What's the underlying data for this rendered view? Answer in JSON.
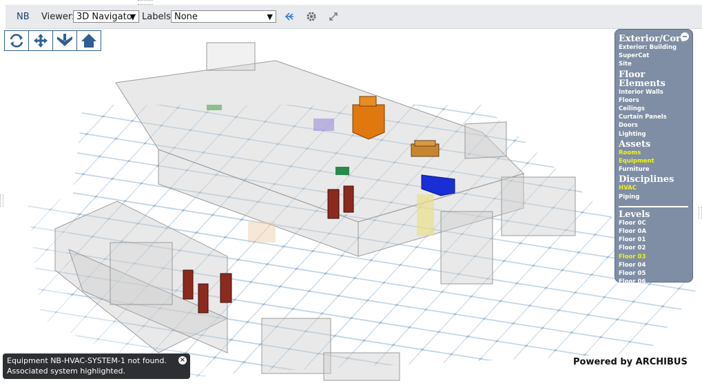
{
  "toolbar": {
    "title": "NB",
    "viewer_label": "Viewer:",
    "viewer_value": "3D Navigator",
    "labels_label": "Labels:",
    "labels_value": "None",
    "icons": [
      "ray-pick-icon",
      "gear-icon",
      "expand-icon"
    ]
  },
  "nav_buttons": [
    "rotate-icon",
    "pan-icon",
    "zoom-down-icon",
    "home-icon"
  ],
  "panel": {
    "sections": [
      {
        "title": "Exterior/Core",
        "items": [
          {
            "label": "Exterior: Building",
            "active": false
          },
          {
            "label": "SuperCat",
            "active": false
          },
          {
            "label": "Site",
            "active": false
          }
        ]
      },
      {
        "title": "Floor Elements",
        "items": [
          {
            "label": "Interior Walls",
            "active": false
          },
          {
            "label": "Floors",
            "active": false
          },
          {
            "label": "Ceilings",
            "active": false
          },
          {
            "label": "Curtain Panels",
            "active": false
          },
          {
            "label": "Doors",
            "active": false
          },
          {
            "label": "Lighting",
            "active": false
          }
        ]
      },
      {
        "title": "Assets",
        "items": [
          {
            "label": "Rooms",
            "active": true
          },
          {
            "label": "Equipment",
            "active": true
          },
          {
            "label": "Furniture",
            "active": false
          }
        ]
      },
      {
        "title": "Disciplines",
        "items": [
          {
            "label": "HVAC",
            "active": true
          },
          {
            "label": "Piping",
            "active": false
          }
        ]
      }
    ],
    "levels_title": "Levels",
    "levels": [
      {
        "label": "Floor 0C",
        "active": false
      },
      {
        "label": "Floor 0A",
        "active": false
      },
      {
        "label": "Floor 01",
        "active": false
      },
      {
        "label": "Floor 02",
        "active": false
      },
      {
        "label": "Floor 03",
        "active": true
      },
      {
        "label": "Floor 04",
        "active": false
      },
      {
        "label": "Floor 05",
        "active": false
      },
      {
        "label": "Floor 06",
        "active": false
      }
    ]
  },
  "message": {
    "line1": "Equipment NB-HVAC-SYSTEM-1 not found.",
    "line2": "Associated system highlighted."
  },
  "powered_by": "Powered by ARCHIBUS",
  "colors": {
    "active_item": "#f2f21a",
    "panel_bg": "#7f8ea4",
    "equipment_orange": "#e07810",
    "equipment_blue": "#1a2ed6",
    "equipment_red": "#8c2a20"
  }
}
